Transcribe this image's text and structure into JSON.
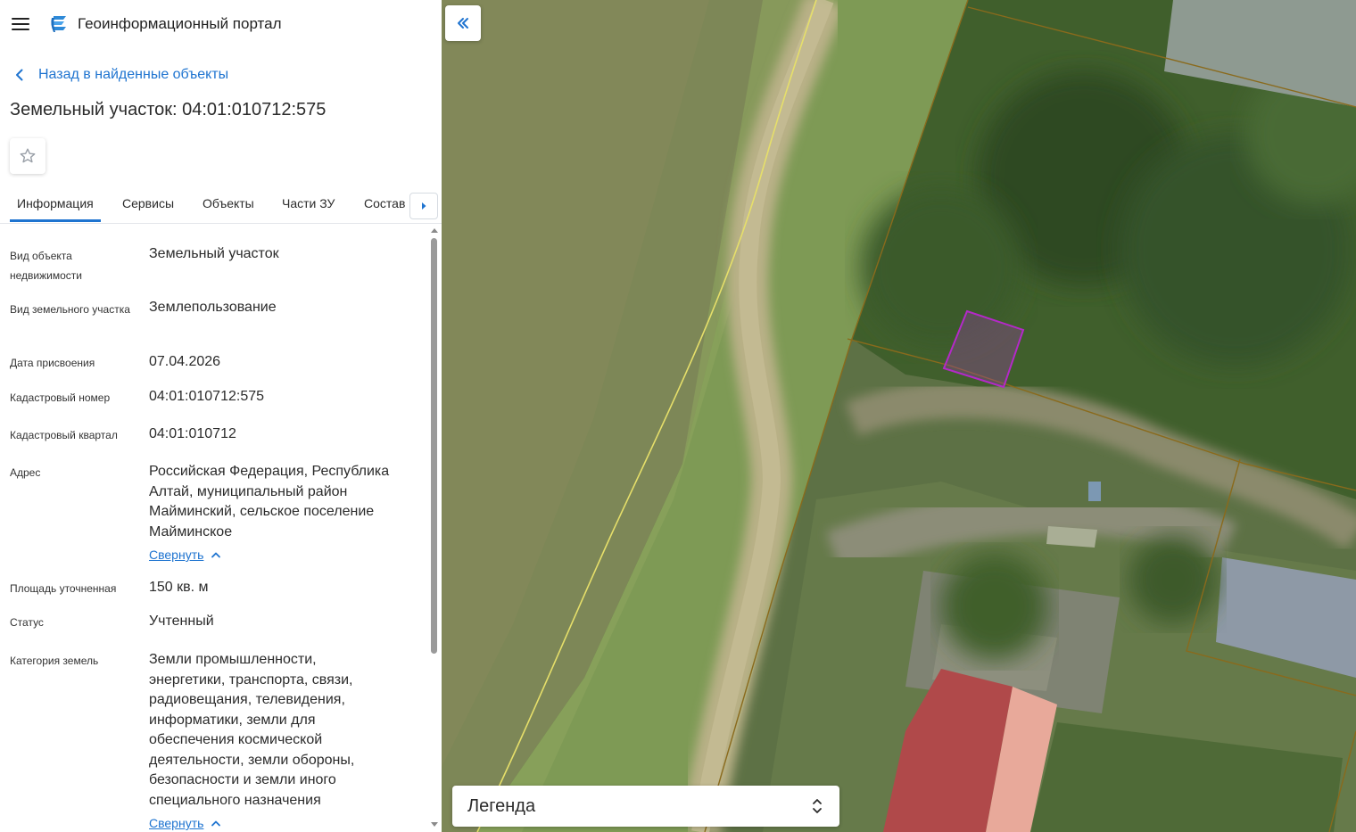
{
  "header": {
    "app_title": "Геоинформационный портал",
    "menu_icon": "hamburger-icon",
    "logo_icon": "portal-logo-icon"
  },
  "back": {
    "label": "Назад в найденные объекты",
    "icon": "chevron-left-icon"
  },
  "object": {
    "title": "Земельный участок: 04:01:010712:575"
  },
  "favorite": {
    "icon": "star-outline-icon"
  },
  "tabs": [
    {
      "label": "Информация",
      "active": true
    },
    {
      "label": "Сервисы",
      "active": false
    },
    {
      "label": "Объекты",
      "active": false
    },
    {
      "label": "Части ЗУ",
      "active": false
    },
    {
      "label": "Состав",
      "active": false
    }
  ],
  "tabs_scroll_icon": "caret-right-icon",
  "info": {
    "rows": [
      {
        "label": "Вид объекта недвижимости",
        "value": "Земельный участок"
      },
      {
        "label": "Вид земельного участка",
        "value": "Землепользование"
      },
      {
        "label": "Дата присвоения",
        "value": "07.04.2026"
      },
      {
        "label": "Кадастровый номер",
        "value": "04:01:010712:575"
      },
      {
        "label": "Кадастровый квартал",
        "value": "04:01:010712"
      },
      {
        "label": "Адрес",
        "value": "Российская Федерация, Республика Алтай, муниципальный район Майминский, сельское поселение Майминское",
        "toggle": "Свернуть"
      },
      {
        "label": "Площадь уточненная",
        "value": "150 кв. м"
      },
      {
        "label": "Статус",
        "value": "Учтенный"
      },
      {
        "label": "Категория земель",
        "value": "Земли промышленности, энергетики, транспорта, связи, радиовещания, телевидения, информатики, земли для обеспечения космической деятельности, земли обороны, безопасности и земли иного специального назначения",
        "toggle": "Свернуть"
      }
    ]
  },
  "map": {
    "collapse_icon": "double-chevron-left-icon",
    "legend_label": "Легенда",
    "legend_icon": "expand-collapse-icon",
    "colors": {
      "selected_parcel": "#b429c8",
      "parcel_border": "#8a6a1c",
      "zone_line": "#e6df6a"
    }
  },
  "colors": {
    "accent": "#1f74d0"
  }
}
